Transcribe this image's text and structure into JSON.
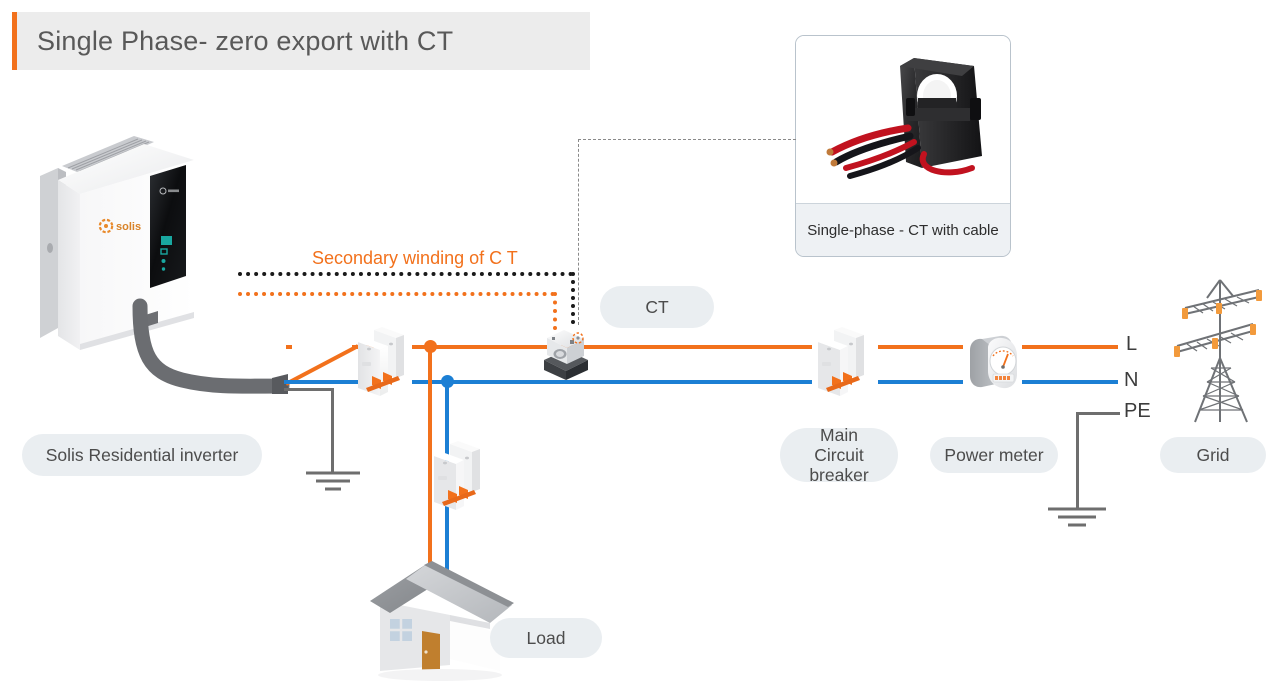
{
  "title": {
    "text": "Single Phase- zero export with CT",
    "accent_color": "#f2711c",
    "background": "#ececec"
  },
  "colors": {
    "line_L": "#f2711c",
    "line_N": "#1c7fd4",
    "line_PE": "#6e6e6e",
    "pill_bg": "#eaeef1",
    "text": "#4c4c4c"
  },
  "diagram": {
    "type": "single-line-wiring-diagram",
    "topology": "Solis single-phase residential inverter -> breaker -> CT clamp on L line -> main circuit breaker -> power meter -> grid, with load branch to house",
    "annotations": {
      "secondary_winding": "Secondary winding of C T"
    },
    "conductors": [
      {
        "name": "L",
        "label": "L",
        "color": "#f2711c",
        "role": "line"
      },
      {
        "name": "N",
        "label": "N",
        "color": "#1c7fd4",
        "role": "neutral"
      },
      {
        "name": "PE",
        "label": "PE",
        "color": "#6e6e6e",
        "role": "protective-earth"
      }
    ],
    "nodes": [
      {
        "id": "inverter",
        "label": "Solis Residential inverter",
        "brand": "Solis"
      },
      {
        "id": "ct",
        "label": "CT"
      },
      {
        "id": "main-breaker",
        "label": "Main Circuit breaker"
      },
      {
        "id": "power-meter",
        "label": "Power meter"
      },
      {
        "id": "grid",
        "label": "Grid"
      },
      {
        "id": "load",
        "label": "Load"
      }
    ],
    "ct_card": {
      "caption": "Single-phase - CT with cable",
      "photo_alt": "black split-core current transformer with red and black cable leads"
    }
  }
}
